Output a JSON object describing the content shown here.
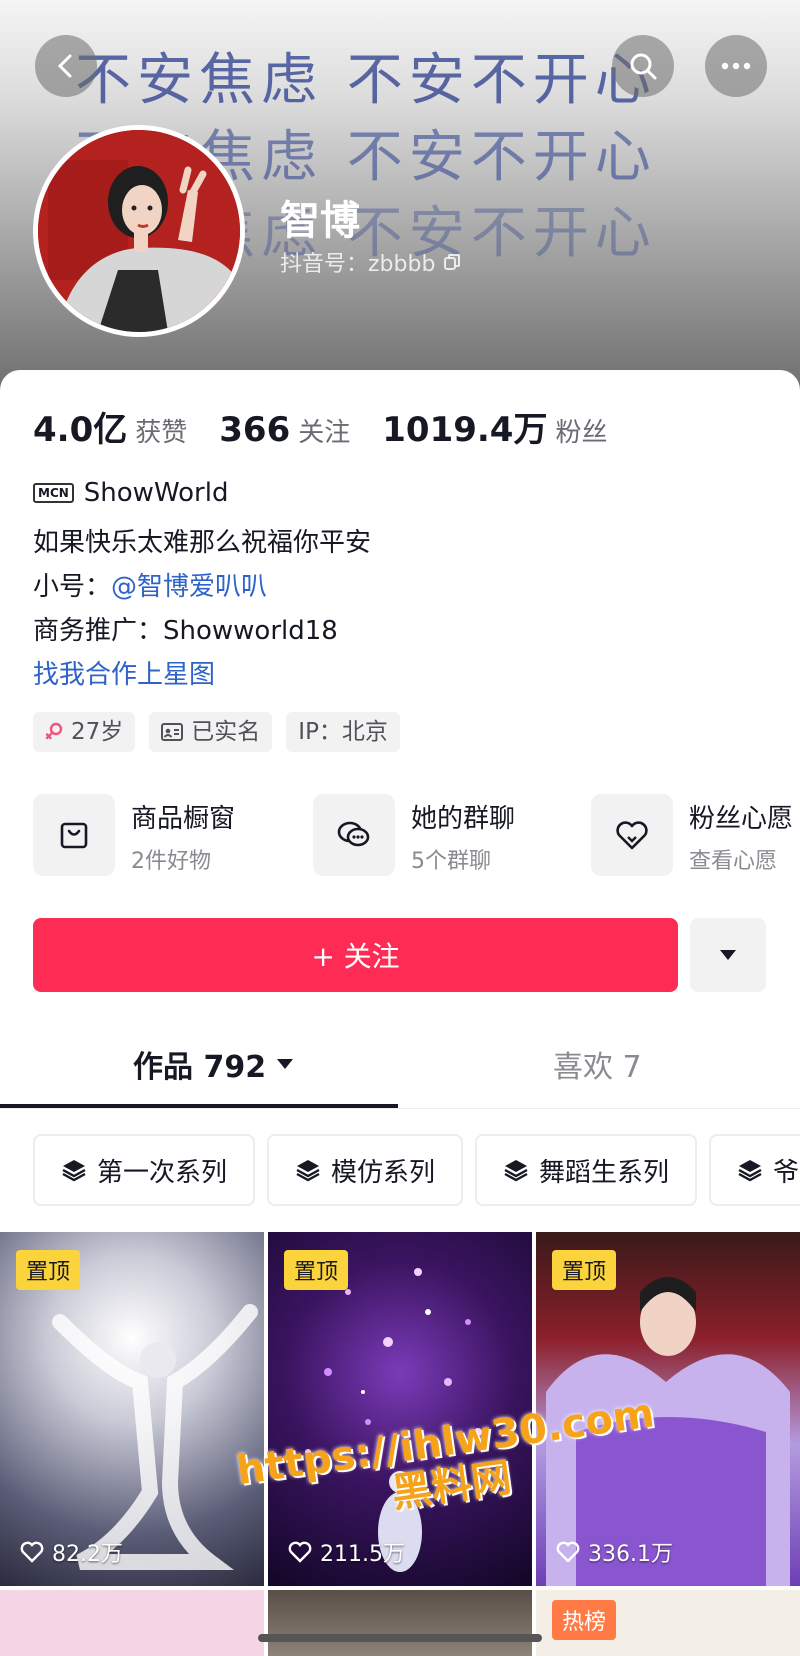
{
  "header": {
    "background_text": [
      "不安焦虑 不安不开心",
      "不安焦虑 不安不开心",
      "不安焦虑 不安不开心"
    ],
    "username": "智博",
    "douyin_id": "抖音号：zbbbb"
  },
  "stats": [
    {
      "num": "4.0亿",
      "label": "获赞"
    },
    {
      "num": "366",
      "label": "关注"
    },
    {
      "num": "1019.4万",
      "label": "粉丝"
    }
  ],
  "mcn": {
    "badge": "MCN",
    "name": "ShowWorld"
  },
  "bio": {
    "line1": "如果快乐太难那么祝福你平安",
    "alt_label": "小号：",
    "alt_link": "@智博爱叭叭",
    "business": "商务推广：Showworld18",
    "star_link": "找我合作上星图"
  },
  "tags": {
    "age": "27岁",
    "verified": "已实名",
    "ip": "IP：北京"
  },
  "features": [
    {
      "title": "商品橱窗",
      "sub": "2件好物"
    },
    {
      "title": "她的群聊",
      "sub": "5个群聊"
    },
    {
      "title": "粉丝心愿",
      "sub": "查看心愿"
    }
  ],
  "follow": {
    "label": "+ 关注"
  },
  "tabs": {
    "works": "作品 792",
    "likes": "喜欢 7"
  },
  "series": [
    "第一次系列",
    "模仿系列",
    "舞蹈生系列",
    "爷"
  ],
  "videos": [
    {
      "badge": "置顶",
      "likes": "82.2万"
    },
    {
      "badge": "置顶",
      "likes": "211.5万"
    },
    {
      "badge": "置顶",
      "likes": "336.1万"
    }
  ],
  "row2_badge": "热榜",
  "watermark": {
    "line1": "https://ihlw30.com",
    "line2": "黑料网"
  },
  "colors": {
    "accent": "#fe2c55",
    "link": "#2f63c9",
    "pin": "#fbd33c"
  }
}
